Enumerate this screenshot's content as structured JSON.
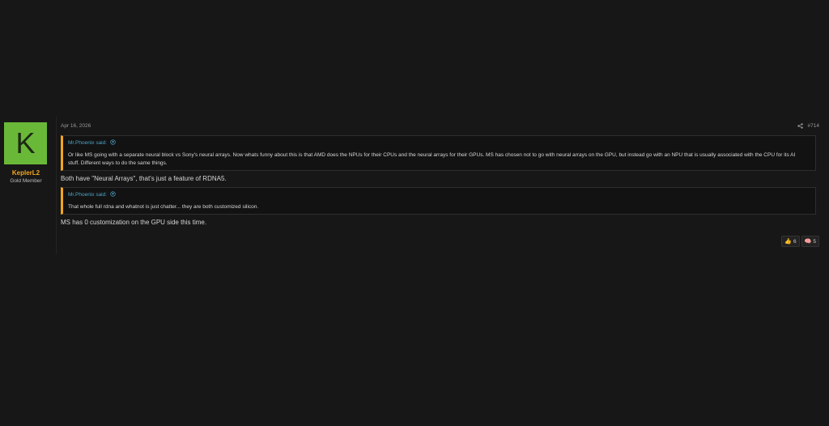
{
  "post": {
    "author": {
      "avatar_letter": "K",
      "name": "KeplerL2",
      "title": "Gold Member"
    },
    "date": "Apr 16, 2026",
    "post_number": "#714",
    "quotes": [
      {
        "author_label": "Mr.Phoenix said:",
        "body": "Or like MS going with a separate neural block vs Sony's neural arrays. Now whats funny about this is that AMD does the NPUs for their CPUs and the neural arrays for their GPUs. MS has chosen not to go with neural arrays on the GPU, but instead go with an NPU that is usually associated with the CPU for its AI stuff. Different ways to do the same things."
      },
      {
        "author_label": "Mr.Phoenix said:",
        "body": "That whole full rdna and whatnot is just chatter... they are both customized silicon."
      }
    ],
    "reply_lines": [
      "Both have \"Neural Arrays\", that's just a feature of RDNA5.",
      "MS has 0 customization on the GPU side this time."
    ],
    "reactions": [
      {
        "icon": "thumbs-up-icon",
        "glyph": "👍",
        "count": "6"
      },
      {
        "icon": "brain-icon",
        "glyph": "🧠",
        "count": "5"
      }
    ]
  },
  "colors": {
    "background": "#171717",
    "accent": "#f1a51f",
    "link": "#4ea3c6",
    "avatar_bg": "#6ab838"
  }
}
